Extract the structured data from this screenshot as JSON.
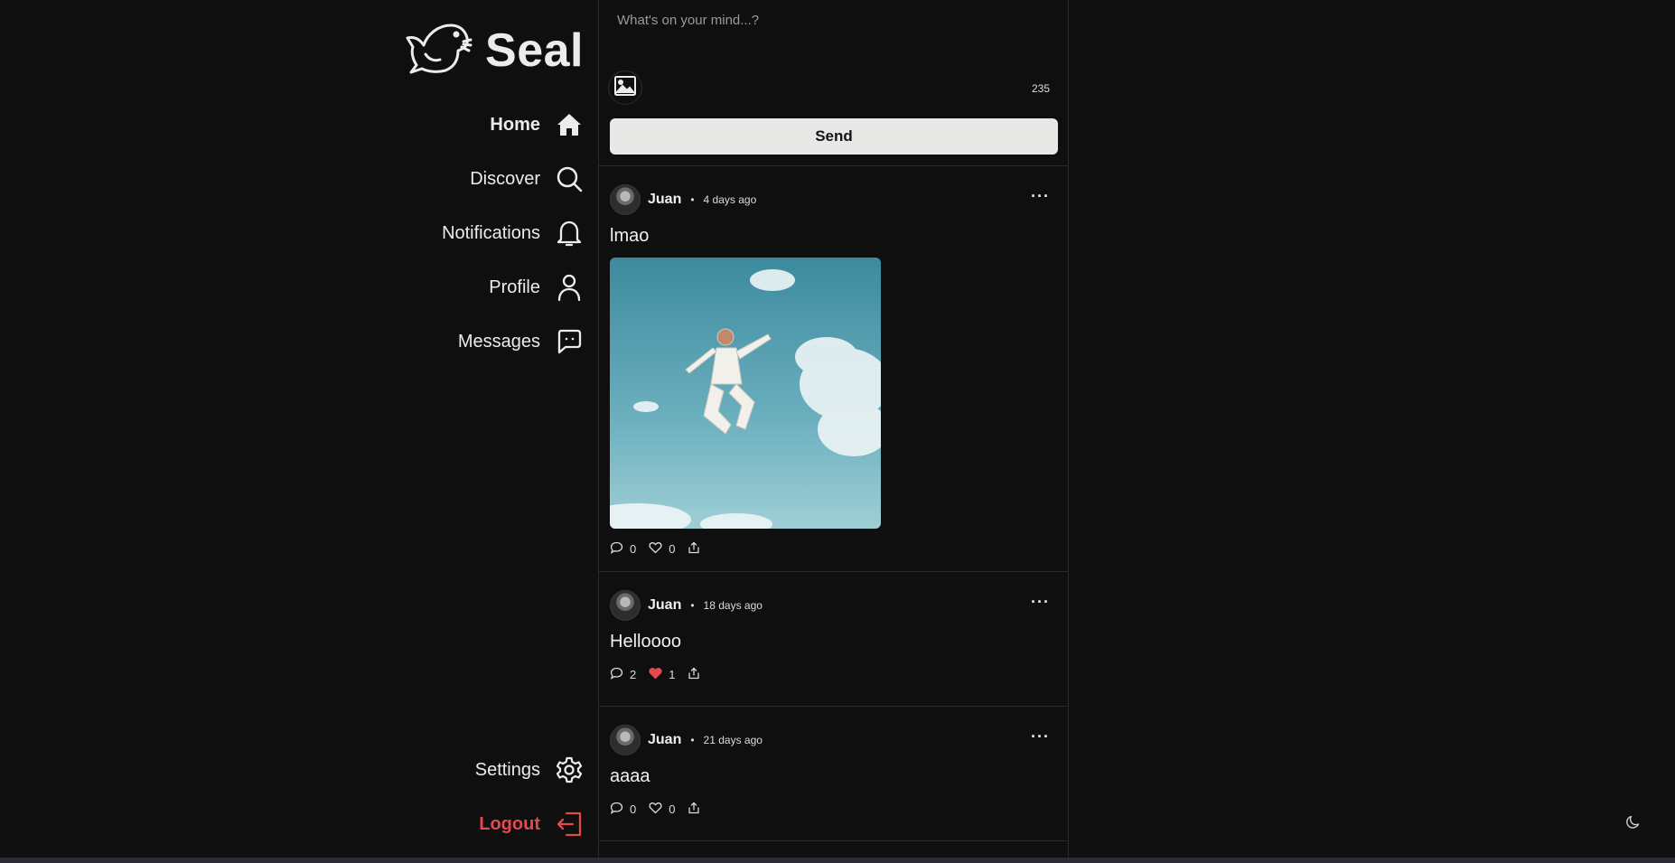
{
  "brand": {
    "name": "Seal",
    "icon": "seal-logo-icon"
  },
  "nav": {
    "items": [
      {
        "label": "Home",
        "icon": "home-icon",
        "active": true
      },
      {
        "label": "Discover",
        "icon": "search-icon"
      },
      {
        "label": "Notifications",
        "icon": "bell-icon"
      },
      {
        "label": "Profile",
        "icon": "user-icon"
      },
      {
        "label": "Messages",
        "icon": "message-icon"
      }
    ],
    "settings": {
      "label": "Settings",
      "icon": "gear-icon"
    },
    "logout": {
      "label": "Logout",
      "icon": "logout-icon"
    }
  },
  "composer": {
    "placeholder": "What's on your mind...?",
    "value": "",
    "char_count": "235",
    "send_label": "Send",
    "image_icon": "image-icon"
  },
  "posts": [
    {
      "author": "Juan",
      "separator": "•",
      "time": "4 days ago",
      "text": "lmao",
      "has_image": true,
      "comments": "0",
      "likes": "0",
      "liked": false
    },
    {
      "author": "Juan",
      "separator": "•",
      "time": "18 days ago",
      "text": "Helloooo",
      "has_image": false,
      "comments": "2",
      "likes": "1",
      "liked": true
    },
    {
      "author": "Juan",
      "separator": "•",
      "time": "21 days ago",
      "text": "aaaa",
      "has_image": false,
      "comments": "0",
      "likes": "0",
      "liked": false
    }
  ],
  "theme_toggle": {
    "icon": "moon-icon"
  },
  "colors": {
    "background": "#0f0f0f",
    "accent_red": "#e5484d",
    "send_button": "#e8e8e6",
    "border": "#2a2a2a"
  }
}
